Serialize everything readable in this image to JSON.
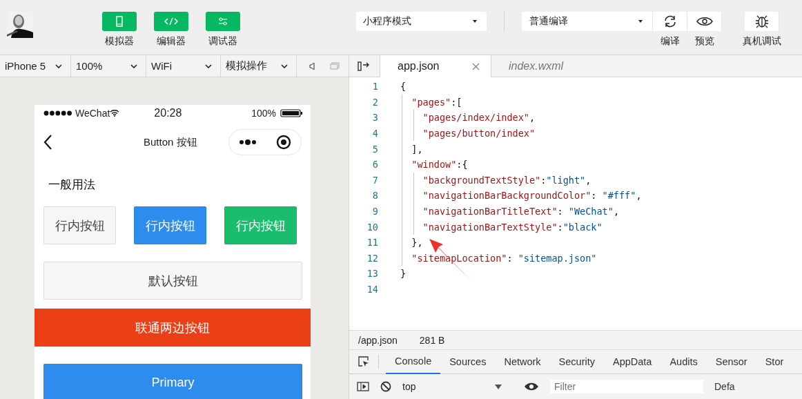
{
  "toolbar": {
    "views": [
      {
        "label": "模拟器",
        "kind": "phone"
      },
      {
        "label": "编辑器",
        "kind": "code"
      },
      {
        "label": "调试器",
        "kind": "sliders"
      }
    ],
    "mode_select": {
      "value": "小程序模式"
    },
    "compile_select": {
      "value": "普通编译"
    },
    "actions": [
      {
        "label": "编译",
        "kind": "refresh"
      },
      {
        "label": "预览",
        "kind": "eye"
      },
      {
        "label": "真机调试",
        "kind": "bug"
      }
    ]
  },
  "device_bar": {
    "selects": [
      "iPhone 5",
      "100%",
      "WiFi",
      "模拟操作"
    ]
  },
  "phone": {
    "status": {
      "carrier": "WeChat",
      "time": "20:28",
      "battery": "100%"
    },
    "title": "Button 按钮",
    "section": "一般用法",
    "buttons": [
      {
        "label": "行内按钮",
        "kind": "inline",
        "color": "#f6f6f6"
      },
      {
        "label": "行内按钮",
        "kind": "inline",
        "color": "#2d8cee"
      },
      {
        "label": "行内按钮",
        "kind": "inline",
        "color": "#19bd6b"
      },
      {
        "label": "默认按钮",
        "kind": "block",
        "color": "#f6f6f6"
      },
      {
        "label": "联通两边按钮",
        "kind": "banner",
        "color": "#eb3f16"
      },
      {
        "label": "Primary",
        "kind": "block",
        "color": "#2d8cee"
      }
    ]
  },
  "editor": {
    "tabs": [
      {
        "label": "app.json",
        "selected": true
      },
      {
        "label": "index.wxml",
        "selected": false
      }
    ],
    "lines": [
      {
        "number": "1",
        "tokens": [
          {
            "kind": "punct",
            "text": "{"
          }
        ]
      },
      {
        "number": "2",
        "tokens": [
          {
            "kind": "key",
            "text": "  \"pages\""
          },
          {
            "kind": "punct",
            "text": ":["
          }
        ]
      },
      {
        "number": "3",
        "tokens": [
          {
            "kind": "key",
            "text": "    \"pages/index/index\""
          },
          {
            "kind": "punct",
            "text": ","
          }
        ]
      },
      {
        "number": "4",
        "tokens": [
          {
            "kind": "key",
            "text": "    \"pages/button/index\""
          }
        ]
      },
      {
        "number": "5",
        "tokens": [
          {
            "kind": "punct",
            "text": "  ],"
          }
        ]
      },
      {
        "number": "6",
        "tokens": [
          {
            "kind": "key",
            "text": "  \"window\""
          },
          {
            "kind": "punct",
            "text": ":{"
          }
        ]
      },
      {
        "number": "7",
        "tokens": [
          {
            "kind": "key",
            "text": "    \"backgroundTextStyle\""
          },
          {
            "kind": "punct",
            "text": ":"
          },
          {
            "kind": "value",
            "text": "\"light\""
          },
          {
            "kind": "punct",
            "text": ","
          }
        ]
      },
      {
        "number": "8",
        "tokens": [
          {
            "kind": "key",
            "text": "    \"navigationBarBackgroundColor\""
          },
          {
            "kind": "punct",
            "text": ": "
          },
          {
            "kind": "value",
            "text": "\"#fff\""
          },
          {
            "kind": "punct",
            "text": ","
          }
        ]
      },
      {
        "number": "9",
        "tokens": [
          {
            "kind": "key",
            "text": "    \"navigationBarTitleText\""
          },
          {
            "kind": "punct",
            "text": ": "
          },
          {
            "kind": "value",
            "text": "\"WeChat\""
          },
          {
            "kind": "punct",
            "text": ","
          }
        ]
      },
      {
        "number": "10",
        "tokens": [
          {
            "kind": "key",
            "text": "    \"navigationBarTextStyle\""
          },
          {
            "kind": "punct",
            "text": ":"
          },
          {
            "kind": "value",
            "text": "\"black\""
          }
        ]
      },
      {
        "number": "11",
        "tokens": [
          {
            "kind": "punct",
            "text": "  },"
          }
        ]
      },
      {
        "number": "12",
        "tokens": [
          {
            "kind": "key",
            "text": "  \"sitemapLocation\""
          },
          {
            "kind": "punct",
            "text": ": "
          },
          {
            "kind": "value",
            "text": "\"sitemap.json\""
          }
        ]
      },
      {
        "number": "13",
        "tokens": [
          {
            "kind": "punct",
            "text": "}"
          }
        ]
      },
      {
        "number": "14"
      }
    ],
    "file_path": "/app.json",
    "file_size": "281 B"
  },
  "devtools": {
    "tabs": [
      {
        "label": "Console",
        "selected": true
      },
      {
        "label": "Sources",
        "selected": false
      },
      {
        "label": "Network",
        "selected": false
      },
      {
        "label": "Security",
        "selected": false
      },
      {
        "label": "AppData",
        "selected": false
      },
      {
        "label": "Audits",
        "selected": false
      },
      {
        "label": "Sensor",
        "selected": false
      },
      {
        "label": "Stor",
        "selected": false
      }
    ],
    "context": "top",
    "filter_placeholder": "Filter",
    "level": "Defa"
  }
}
